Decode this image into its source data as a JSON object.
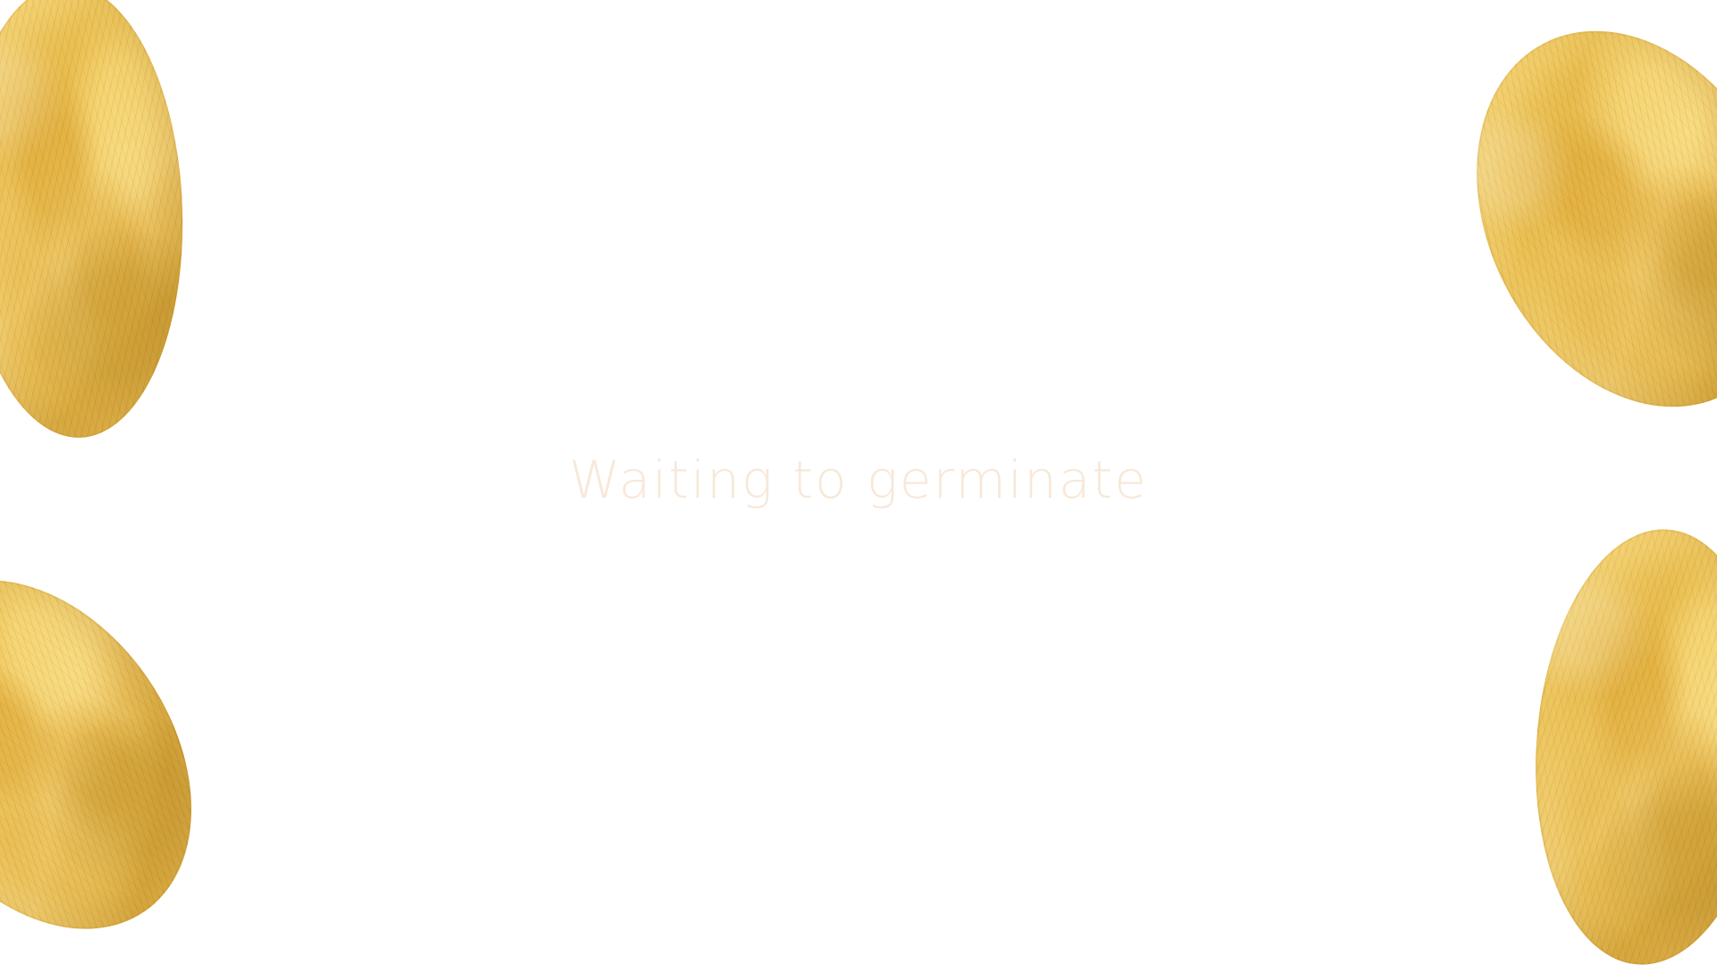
{
  "screen": {
    "status_message": "Waiting to germinate",
    "background_color": "#ffffff",
    "message_color": "#f6e2cf",
    "fur_color": "#e7bd54"
  },
  "decorations": [
    {
      "name": "fur-blob-top-left"
    },
    {
      "name": "fur-blob-bottom-left"
    },
    {
      "name": "fur-blob-top-right"
    },
    {
      "name": "fur-blob-bottom-right"
    }
  ]
}
